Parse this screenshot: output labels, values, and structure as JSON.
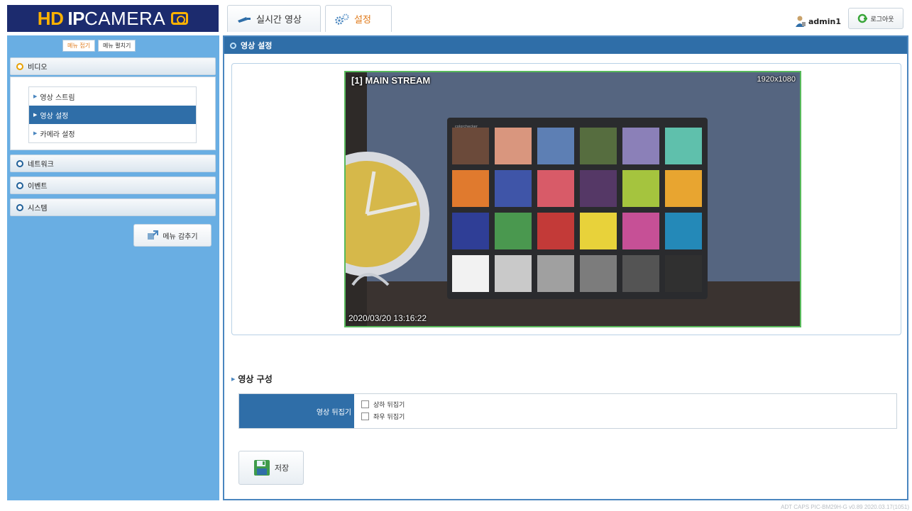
{
  "logo": {
    "part1": "HD",
    "part2": "IP",
    "part3": "CAMERA"
  },
  "tabs": [
    {
      "label": "실시간 영상",
      "icon": "camera-icon",
      "active": false
    },
    {
      "label": "설정",
      "icon": "gear-icon",
      "active": true
    }
  ],
  "user": {
    "name": "admin1",
    "icon": "user-icon"
  },
  "logout": {
    "label": "로그아웃",
    "icon": "power-icon"
  },
  "sidebar": {
    "toggles": [
      "메뉴 접기",
      "메뉴 펼치기"
    ],
    "menus": [
      {
        "label": "비디오",
        "open": true,
        "items": [
          {
            "label": "영상 스트림",
            "selected": false
          },
          {
            "label": "영상 설정",
            "selected": true
          },
          {
            "label": "카메라 설정",
            "selected": false
          }
        ]
      },
      {
        "label": "네트워크",
        "open": false
      },
      {
        "label": "이벤트",
        "open": false
      },
      {
        "label": "시스템",
        "open": false
      }
    ],
    "collapse_label": "메뉴 감추기"
  },
  "main": {
    "header": "영상 설정",
    "video": {
      "stream_label": "[1] MAIN STREAM",
      "top_right_osd": "1920x1080",
      "timestamp": "2020/03/20 13:16:22"
    },
    "section_title": "영상 구성",
    "flip": {
      "label": "영상 뒤집기",
      "options": [
        {
          "label": "상하 뒤집기",
          "checked": false
        },
        {
          "label": "좌우 뒤집기",
          "checked": false
        }
      ]
    },
    "save_label": "저장"
  },
  "version": "ADT CAPS PIC-BM29H-G v0.89 2020.03.17(1051)",
  "colors": {
    "accent": "#2f6ea8",
    "sidebar": "#69aee3",
    "logo_bg": "#1c2b6e",
    "logo_accent": "#ffb200",
    "active_tab_text": "#e07a1a"
  }
}
